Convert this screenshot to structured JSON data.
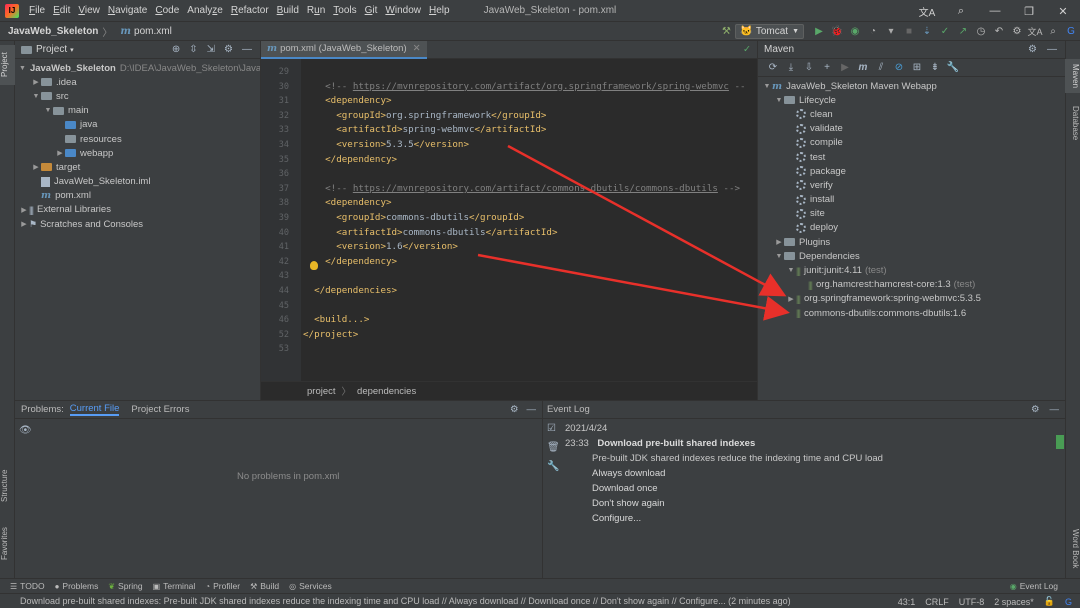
{
  "window": {
    "title": "JavaWeb_Skeleton - pom.xml"
  },
  "menu": [
    {
      "label": "File",
      "u": "F"
    },
    {
      "label": "Edit",
      "u": "E"
    },
    {
      "label": "View",
      "u": "V"
    },
    {
      "label": "Navigate",
      "u": "N"
    },
    {
      "label": "Code",
      "u": "C"
    },
    {
      "label": "Analyze",
      "u": "z"
    },
    {
      "label": "Refactor",
      "u": "R"
    },
    {
      "label": "Build",
      "u": "B"
    },
    {
      "label": "Run",
      "u": "u"
    },
    {
      "label": "Tools",
      "u": "T"
    },
    {
      "label": "Git",
      "u": "G"
    },
    {
      "label": "Window",
      "u": "W"
    },
    {
      "label": "Help",
      "u": "H"
    }
  ],
  "breadcrumb": {
    "project": "JavaWeb_Skeleton",
    "file": "pom.xml"
  },
  "run_config": {
    "label": "Tomcat"
  },
  "side_tabs": {
    "project": "Project",
    "structure": "Structure",
    "favorites": "Favorites",
    "maven": "Maven",
    "database": "Database",
    "word_book": "Word Book"
  },
  "project_panel": {
    "title": "Project",
    "tree": [
      {
        "depth": 0,
        "arrow": "down",
        "icon": "folder",
        "label": "JavaWeb_Skeleton",
        "bold": true,
        "extra": "D:\\IDEA\\JavaWeb_Skeleton\\Java"
      },
      {
        "depth": 1,
        "arrow": "right",
        "icon": "folder",
        "label": ".idea"
      },
      {
        "depth": 1,
        "arrow": "down",
        "icon": "folder",
        "label": "src"
      },
      {
        "depth": 2,
        "arrow": "down",
        "icon": "folder",
        "label": "main"
      },
      {
        "depth": 3,
        "arrow": "",
        "icon": "folder-blue",
        "label": "java"
      },
      {
        "depth": 3,
        "arrow": "",
        "icon": "folder",
        "label": "resources"
      },
      {
        "depth": 3,
        "arrow": "right",
        "icon": "folder-blue",
        "label": "webapp"
      },
      {
        "depth": 1,
        "arrow": "right",
        "icon": "folder-orange",
        "label": "target"
      },
      {
        "depth": 1,
        "arrow": "",
        "icon": "file",
        "label": "JavaWeb_Skeleton.iml"
      },
      {
        "depth": 1,
        "arrow": "",
        "icon": "maven",
        "label": "pom.xml"
      },
      {
        "depth": 0,
        "arrow": "right",
        "icon": "lib",
        "label": "External Libraries"
      },
      {
        "depth": 0,
        "arrow": "right",
        "icon": "scratch",
        "label": "Scratches and Consoles"
      }
    ]
  },
  "editor": {
    "tab": "pom.xml (JavaWeb_Skeleton)",
    "lines": [
      {
        "n": "29",
        "indent": "",
        "kind": "blank",
        "text": ""
      },
      {
        "n": "30",
        "indent": "    ",
        "kind": "comment",
        "pre": "<!-- ",
        "link": "https://mvnrepository.com/artifact/org.springframework/spring-webmvc",
        "post": " --"
      },
      {
        "n": "31",
        "indent": "    ",
        "kind": "tag",
        "text": "<dependency>"
      },
      {
        "n": "32",
        "indent": "      ",
        "kind": "elem",
        "open": "<groupId>",
        "value": "org.springframework",
        "close": "</groupId>"
      },
      {
        "n": "33",
        "indent": "      ",
        "kind": "elem",
        "open": "<artifactId>",
        "value": "spring-webmvc",
        "close": "</artifactId>"
      },
      {
        "n": "34",
        "indent": "      ",
        "kind": "elem",
        "open": "<version>",
        "value": "5.3.5",
        "close": "</version>"
      },
      {
        "n": "35",
        "indent": "    ",
        "kind": "tag",
        "text": "</dependency>"
      },
      {
        "n": "36",
        "indent": "",
        "kind": "blank",
        "text": ""
      },
      {
        "n": "37",
        "indent": "    ",
        "kind": "comment",
        "pre": "<!-- ",
        "link": "https://mvnrepository.com/artifact/commons-dbutils/commons-dbutils",
        "post": " -->"
      },
      {
        "n": "38",
        "indent": "    ",
        "kind": "tag",
        "text": "<dependency>"
      },
      {
        "n": "39",
        "indent": "      ",
        "kind": "elem",
        "open": "<groupId>",
        "value": "commons-dbutils",
        "close": "</groupId>"
      },
      {
        "n": "40",
        "indent": "      ",
        "kind": "elem",
        "open": "<artifactId>",
        "value": "commons-dbutils",
        "close": "</artifactId>"
      },
      {
        "n": "41",
        "indent": "      ",
        "kind": "elem",
        "open": "<version>",
        "value": "1.6",
        "close": "</version>"
      },
      {
        "n": "42",
        "indent": "    ",
        "kind": "tag",
        "text": "</dependency>"
      },
      {
        "n": "43",
        "indent": "",
        "kind": "blank",
        "text": ""
      },
      {
        "n": "44",
        "indent": "  ",
        "kind": "tag",
        "text": "</dependencies>"
      },
      {
        "n": "45",
        "indent": "",
        "kind": "blank",
        "text": ""
      },
      {
        "n": "46",
        "indent": "  ",
        "kind": "tag",
        "text": "<build...>"
      },
      {
        "n": "52",
        "indent": "",
        "kind": "tag",
        "text": "</project>"
      },
      {
        "n": "53",
        "indent": "",
        "kind": "blank",
        "text": ""
      }
    ],
    "breadcrumb": [
      "project",
      "dependencies"
    ]
  },
  "maven": {
    "title": "Maven",
    "tree": [
      {
        "depth": 0,
        "arrow": "down",
        "icon": "maven",
        "label": "JavaWeb_Skeleton Maven Webapp"
      },
      {
        "depth": 1,
        "arrow": "down",
        "icon": "folder",
        "label": "Lifecycle"
      },
      {
        "depth": 2,
        "arrow": "",
        "icon": "gear",
        "label": "clean"
      },
      {
        "depth": 2,
        "arrow": "",
        "icon": "gear",
        "label": "validate"
      },
      {
        "depth": 2,
        "arrow": "",
        "icon": "gear",
        "label": "compile"
      },
      {
        "depth": 2,
        "arrow": "",
        "icon": "gear",
        "label": "test"
      },
      {
        "depth": 2,
        "arrow": "",
        "icon": "gear",
        "label": "package"
      },
      {
        "depth": 2,
        "arrow": "",
        "icon": "gear",
        "label": "verify"
      },
      {
        "depth": 2,
        "arrow": "",
        "icon": "gear",
        "label": "install"
      },
      {
        "depth": 2,
        "arrow": "",
        "icon": "gear",
        "label": "site"
      },
      {
        "depth": 2,
        "arrow": "",
        "icon": "gear",
        "label": "deploy"
      },
      {
        "depth": 1,
        "arrow": "right",
        "icon": "folder",
        "label": "Plugins"
      },
      {
        "depth": 1,
        "arrow": "down",
        "icon": "folder",
        "label": "Dependencies"
      },
      {
        "depth": 2,
        "arrow": "down",
        "icon": "bars",
        "label": "junit:junit:4.11",
        "suffix": "(test)"
      },
      {
        "depth": 3,
        "arrow": "",
        "icon": "bars",
        "label": "org.hamcrest:hamcrest-core:1.3",
        "suffix": "(test)"
      },
      {
        "depth": 2,
        "arrow": "right",
        "icon": "bars",
        "label": "org.springframework:spring-webmvc:5.3.5"
      },
      {
        "depth": 2,
        "arrow": "",
        "icon": "bars",
        "label": "commons-dbutils:commons-dbutils:1.6"
      }
    ]
  },
  "problems": {
    "title": "Problems:",
    "tabs": [
      "Current File",
      "Project Errors"
    ],
    "empty_text": "No problems in pom.xml"
  },
  "event_log": {
    "title": "Event Log",
    "date": "2021/4/24",
    "time": "23:33",
    "headline": "Download pre-built shared indexes",
    "message": "Pre-built JDK shared indexes reduce the indexing time and CPU load",
    "links": [
      "Always download",
      "Download once",
      "Don't show again",
      "Configure..."
    ]
  },
  "tool_buttons": [
    {
      "icon": "todo-icon",
      "label": "TODO"
    },
    {
      "icon": "problems-icon",
      "label": "Problems"
    },
    {
      "icon": "spring-icon",
      "label": "Spring"
    },
    {
      "icon": "terminal-icon",
      "label": "Terminal"
    },
    {
      "icon": "profiler-icon",
      "label": "Profiler"
    },
    {
      "icon": "build-icon",
      "label": "Build"
    },
    {
      "icon": "services-icon",
      "label": "Services"
    }
  ],
  "event_log_button": "Event Log",
  "status": {
    "message": "Download pre-built shared indexes: Pre-built JDK shared indexes reduce the indexing time and CPU load // Always download // Download once // Don't show again // Configure... (2 minutes ago)",
    "position": "43:1",
    "line_sep": "CRLF",
    "encoding": "UTF-8",
    "indent": "2 spaces*"
  },
  "colors": {
    "accent": "#589df6",
    "arrow": "#e8302a",
    "tag": "#e8bf6a",
    "comment": "#808080"
  }
}
